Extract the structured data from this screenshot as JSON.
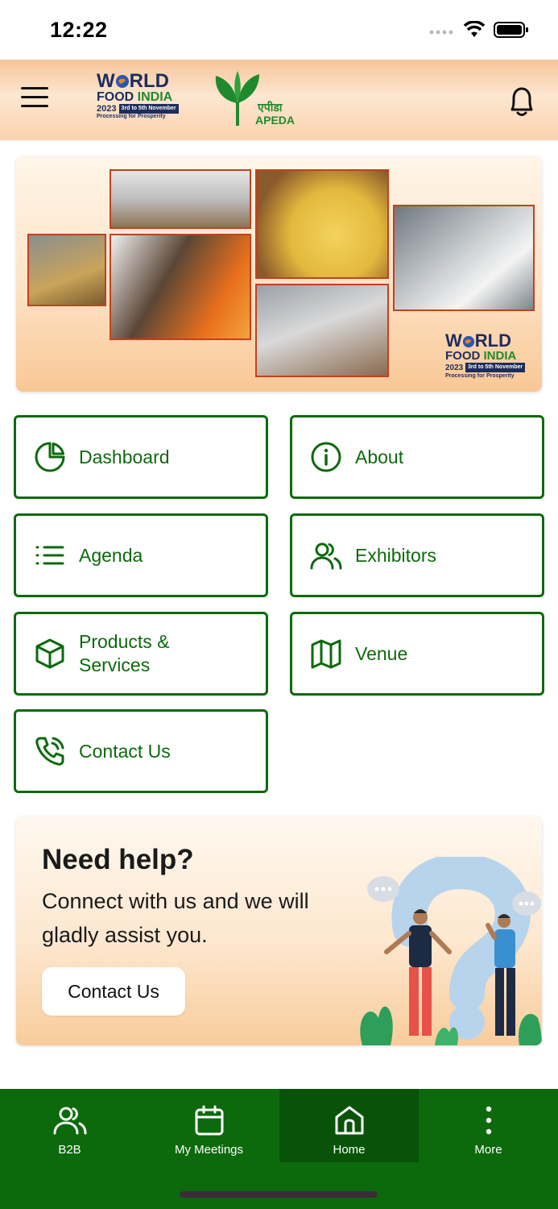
{
  "status_bar": {
    "time": "12:22"
  },
  "header": {
    "menu_icon": "hamburger-icon",
    "logo_world": "W",
    "logo_rld": "RLD",
    "logo_food": "FOOD",
    "logo_india": "INDIA",
    "logo_year": "2023",
    "logo_dates": "3rd to 5th November",
    "logo_tagline": "Processing for Prosperity",
    "apeda_hindi": "एपीडा",
    "apeda_text": "APEDA",
    "notification_icon": "bell-icon"
  },
  "banner": {
    "logo_world": "W",
    "logo_rld": "RLD",
    "logo_food": "FOOD",
    "logo_india": "INDIA",
    "logo_year": "2023",
    "logo_dates": "3rd to 5th November",
    "logo_tagline": "Processing for Prosperity"
  },
  "menu": [
    {
      "label": "Dashboard",
      "icon": "pie-chart-icon"
    },
    {
      "label": "About",
      "icon": "info-icon"
    },
    {
      "label": "Agenda",
      "icon": "list-icon"
    },
    {
      "label": "Exhibitors",
      "icon": "users-icon"
    },
    {
      "label": "Products &",
      "label2": "Services",
      "icon": "box-icon"
    },
    {
      "label": "Venue",
      "icon": "map-icon"
    },
    {
      "label": "Contact Us",
      "icon": "phone-call-icon"
    }
  ],
  "help": {
    "title": "Need help?",
    "text": "Connect with us and we will gladly assist you.",
    "button": "Contact Us"
  },
  "bottom_nav": [
    {
      "label": "B2B",
      "icon": "users-icon"
    },
    {
      "label": "My Meetings",
      "icon": "calendar-icon"
    },
    {
      "label": "Home",
      "icon": "home-icon",
      "active": true
    },
    {
      "label": "More",
      "icon": "more-vertical-icon"
    }
  ],
  "colors": {
    "primary_green": "#0c6a0c",
    "active_nav": "#085308",
    "header_orange": "#f6c49a"
  }
}
